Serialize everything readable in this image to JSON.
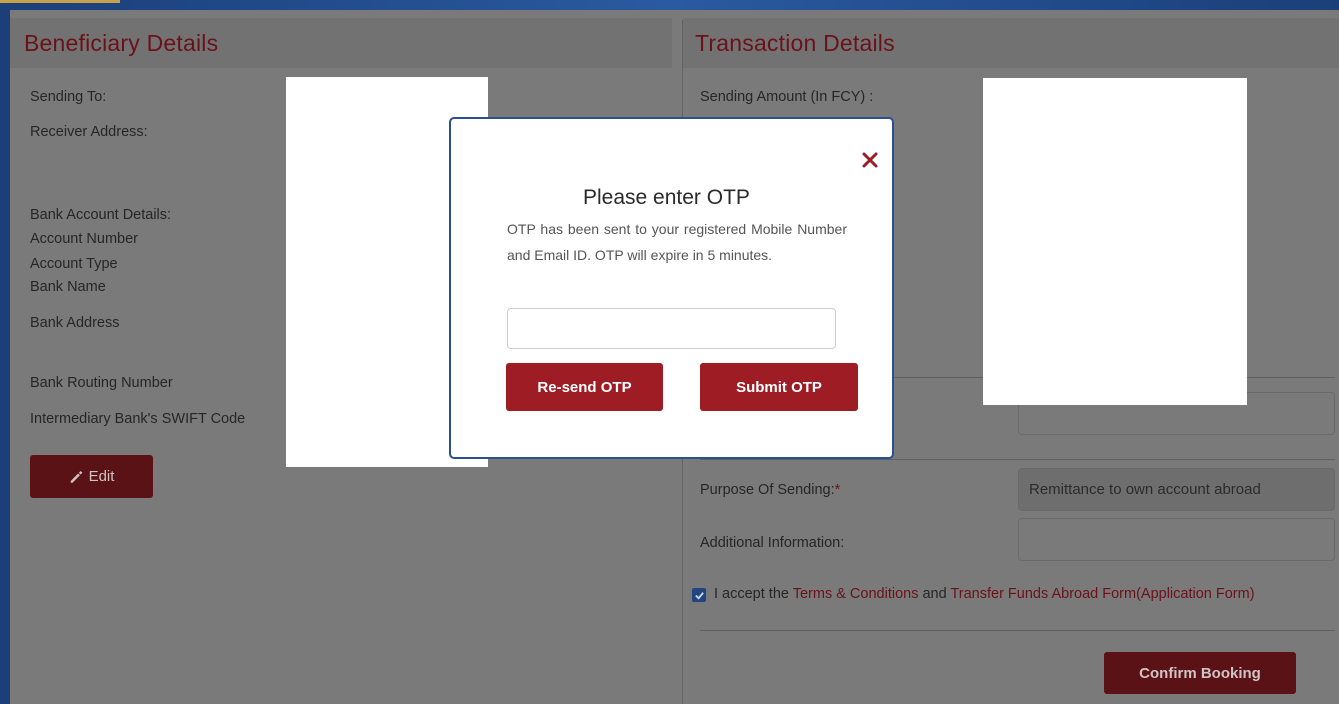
{
  "beneficiary": {
    "title": "Beneficiary Details",
    "sending_to": "Sending To:",
    "receiver_address": "Receiver Address:",
    "bank_account_details": "Bank Account Details:",
    "account_number": "Account Number",
    "account_type": "Account Type",
    "bank_name": "Bank Name",
    "bank_address": "Bank Address",
    "bank_routing_number": "Bank Routing Number",
    "swift_code": "Intermediary Bank's SWIFT Code",
    "edit_label": "Edit",
    "edit_icon": "pencil-icon"
  },
  "transaction": {
    "title": "Transaction Details",
    "sending_amount": "Sending Amount (In FCY) :",
    "purpose_label": "Purpose Of Sending:",
    "required_mark": "*",
    "purpose_value": "Remittance to own account abroad",
    "additional_info_label": "Additional Information:",
    "additional_info_value": "",
    "terms_prefix": "I accept the ",
    "terms_link": "Terms & Conditions",
    "terms_and": " and ",
    "form_link": "Transfer Funds Abroad Form(Application Form)",
    "terms_checked": true,
    "confirm_label": "Confirm Booking"
  },
  "otp_modal": {
    "title": "Please enter OTP",
    "message": "OTP has been sent to your registered Mobile Number and Email ID. OTP will expire in 5 minutes.",
    "otp_value": "",
    "resend_label": "Re-send OTP",
    "submit_label": "Submit OTP",
    "close_icon": "close-icon"
  },
  "colors": {
    "accent": "#9e1c24",
    "title_red": "#6b1219",
    "modal_border": "#2a4f92",
    "overlay_gray": "#7a7a7a"
  }
}
